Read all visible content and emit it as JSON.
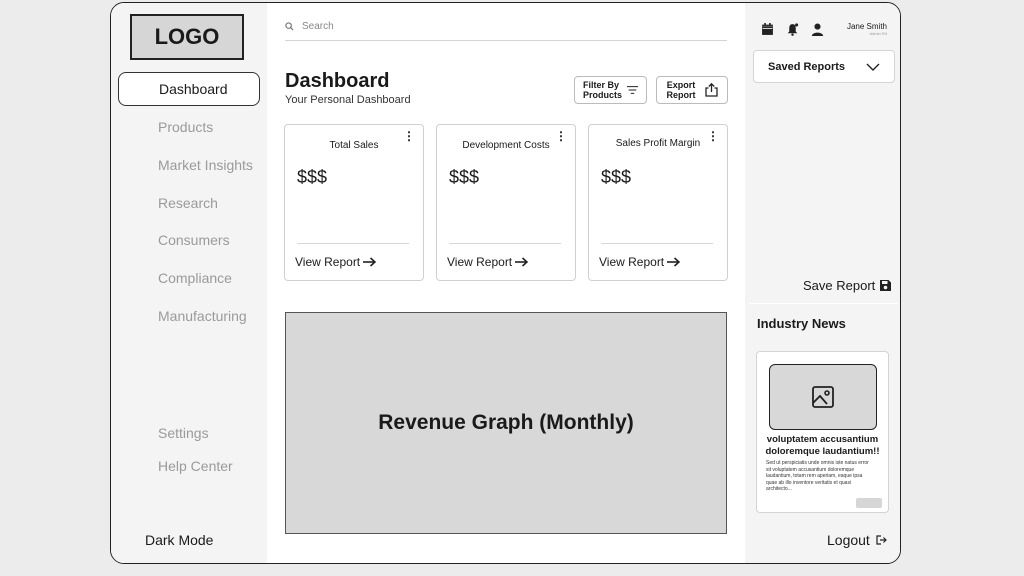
{
  "sidebar": {
    "logo": "LOGO",
    "nav": [
      "Dashboard",
      "Products",
      "Market Insights",
      "Research",
      "Consumers",
      "Compliance",
      "Manufacturing"
    ],
    "bottom": [
      "Settings",
      "Help Center"
    ],
    "dark_mode": "Dark Mode"
  },
  "search": {
    "placeholder": "Search"
  },
  "header": {
    "title": "Dashboard",
    "subtitle": "Your Personal Dashboard",
    "filter_button": "Filter By Products",
    "export_button": "Export Report"
  },
  "cards": [
    {
      "title": "Total Sales",
      "value": "$$$",
      "link": "View Report"
    },
    {
      "title": "Development Costs",
      "value": "$$$",
      "link": "View Report"
    },
    {
      "title": "Sales Profit Margin",
      "value": "$$$",
      "link": "View Report"
    }
  ],
  "graph": {
    "label": "Revenue Graph (Monthly)"
  },
  "right": {
    "user_name": "Jane Smith",
    "user_role": "Admin R3",
    "saved_reports": "Saved Reports",
    "save_report": "Save Report",
    "news_title": "Industry News",
    "news_headline": "voluptatem accusantium doloremque laudantium!!",
    "news_body": "Sed ut perspiciatis unde omnis iste natus error sit voluptatem accusantium doloremque laudantium, totam rem aperiam, eaque ipsa quae ab illo inventore veritatis et quasi architecto...",
    "logout": "Logout"
  }
}
